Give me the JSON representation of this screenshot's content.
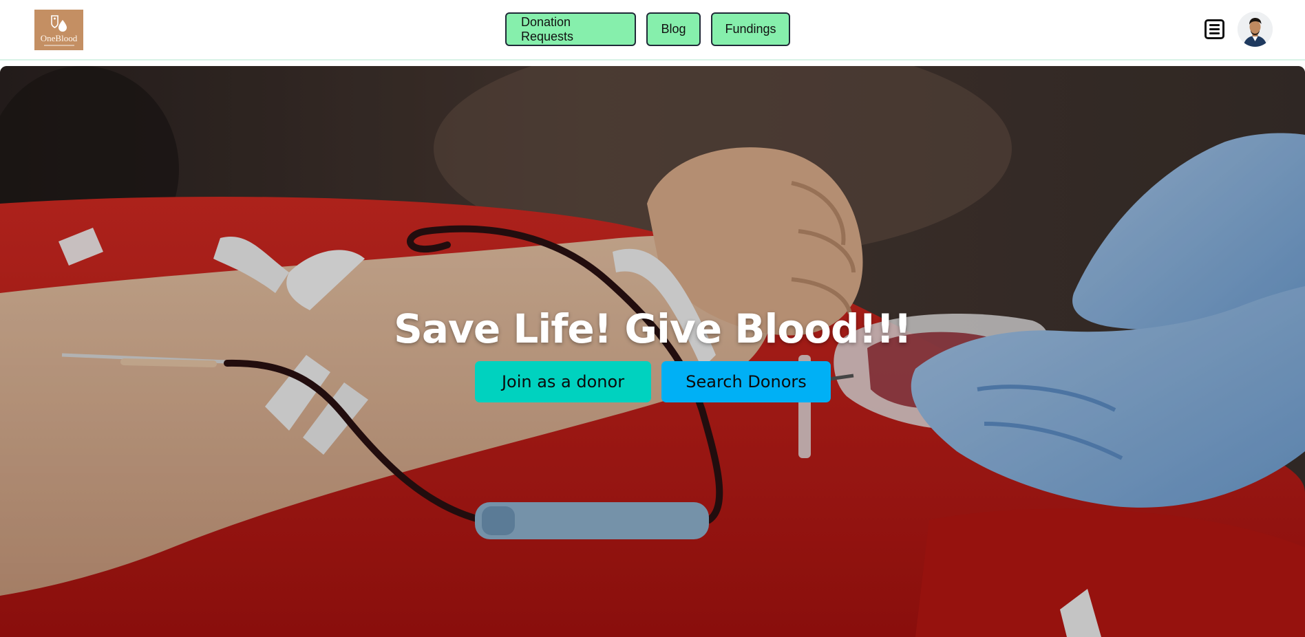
{
  "brand": {
    "logo_text": "OneBlood",
    "logo_color": "#c48f63"
  },
  "nav": {
    "links": [
      {
        "label": "Donation Requests"
      },
      {
        "label": "Blog"
      },
      {
        "label": "Fundings"
      }
    ],
    "link_bg": "#86efac",
    "menu_icon": "hamburger-menu-icon",
    "avatar": "user-avatar"
  },
  "hero": {
    "title": "Save Life! Give Blood!!!",
    "join_label": "Join as a donor",
    "search_label": "Search Donors",
    "join_color": "#00d2bf",
    "search_color": "#00b0f5"
  }
}
